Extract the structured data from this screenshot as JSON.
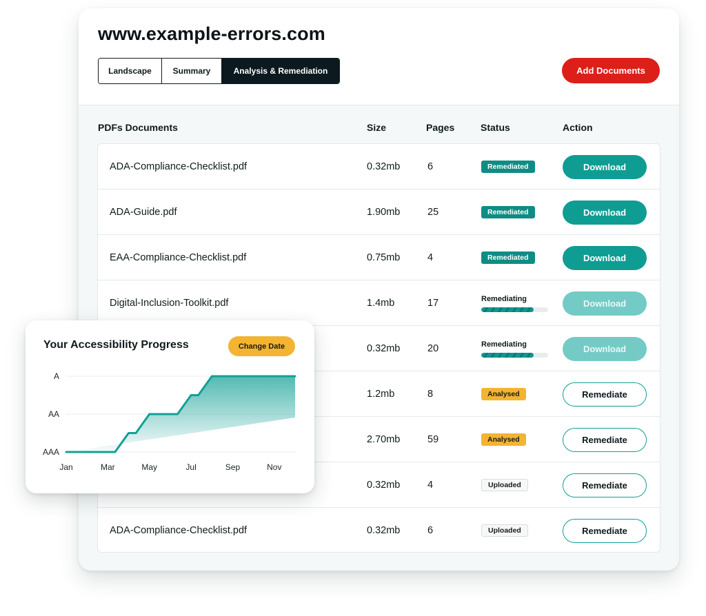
{
  "header": {
    "site": "www.example-errors.com",
    "tabs": [
      {
        "label": "Landscape",
        "active": false
      },
      {
        "label": "Summary",
        "active": false
      },
      {
        "label": "Analysis & Remediation",
        "active": true
      }
    ],
    "add_documents": "Add Documents"
  },
  "table": {
    "columns": [
      "PDFs Documents",
      "Size",
      "Pages",
      "Status",
      "Action"
    ],
    "rows": [
      {
        "name": "ADA-Compliance-Checklist.pdf",
        "size": "0.32mb",
        "pages": "6",
        "status": "Remediated",
        "action": "Download"
      },
      {
        "name": "ADA-Guide.pdf",
        "size": "1.90mb",
        "pages": "25",
        "status": "Remediated",
        "action": "Download"
      },
      {
        "name": "EAA-Compliance-Checklist.pdf",
        "size": "0.75mb",
        "pages": "4",
        "status": "Remediated",
        "action": "Download"
      },
      {
        "name": "Digital-Inclusion-Toolkit.pdf",
        "size": "1.4mb",
        "pages": "17",
        "status": "Remediating",
        "progress": 0.78,
        "action": "Download"
      },
      {
        "name": "",
        "size": "0.32mb",
        "pages": "20",
        "status": "Remediating",
        "progress": 0.78,
        "action": "Download"
      },
      {
        "name": "",
        "size": "1.2mb",
        "pages": "8",
        "status": "Analysed",
        "action": "Remediate"
      },
      {
        "name": "",
        "size": "2.70mb",
        "pages": "59",
        "status": "Analysed",
        "action": "Remediate"
      },
      {
        "name": "",
        "size": "0.32mb",
        "pages": "4",
        "status": "Uploaded",
        "action": "Remediate"
      },
      {
        "name": "ADA-Compliance-Checklist.pdf",
        "size": "0.32mb",
        "pages": "6",
        "status": "Uploaded",
        "action": "Remediate"
      }
    ]
  },
  "progress_card": {
    "title": "Your Accessibility Progress",
    "change_date": "Change Date"
  },
  "chart_data": {
    "type": "line",
    "x": [
      "Jan",
      "Feb",
      "Mar",
      "Apr",
      "May",
      "Jun",
      "Jul",
      "Aug",
      "Sep",
      "Oct",
      "Nov",
      "Dec"
    ],
    "x_tick_labels": [
      "Jan",
      "Mar",
      "May",
      "Jul",
      "Sep",
      "Nov"
    ],
    "y_categories": [
      "AAA",
      "AA",
      "A"
    ],
    "values": [
      0,
      0,
      0,
      0.5,
      1,
      1,
      1.5,
      2,
      2,
      2,
      2,
      2
    ],
    "grid": true,
    "area_fill": true
  },
  "colors": {
    "accent": "#0f9d93",
    "danger": "#dd1f1a",
    "warning": "#f2b431",
    "dark": "#0c1a20"
  }
}
